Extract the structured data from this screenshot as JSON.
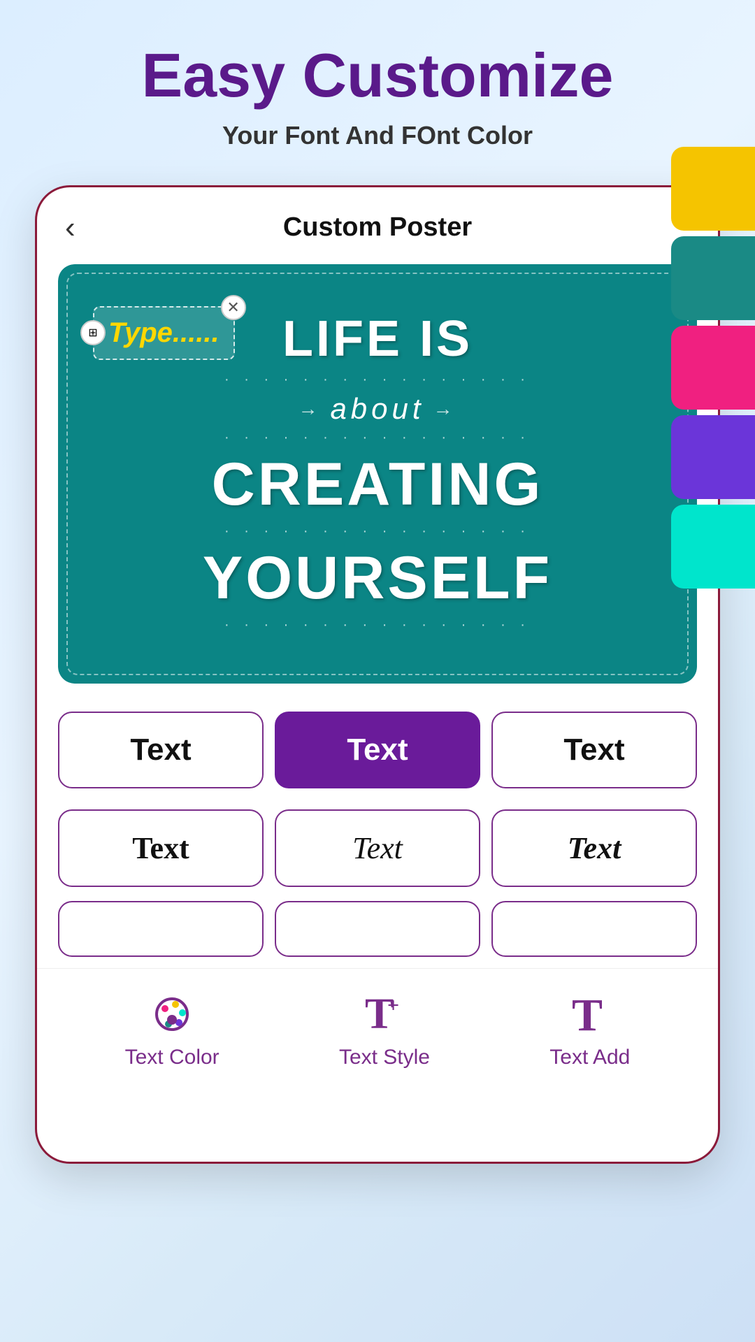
{
  "header": {
    "title": "Easy Customize",
    "subtitle": "Your Font And FOnt Color"
  },
  "app_bar": {
    "title": "Custom Poster",
    "back_label": "‹"
  },
  "poster": {
    "typing_text": "Type......",
    "line1": "LIFE IS",
    "line2": "about",
    "line3": "CREATING",
    "line4": "YOURSELF"
  },
  "colors": [
    {
      "name": "yellow",
      "hex": "#F5C400"
    },
    {
      "name": "teal",
      "hex": "#1a8a85"
    },
    {
      "name": "pink",
      "hex": "#f02080"
    },
    {
      "name": "purple",
      "hex": "#6b35d9"
    },
    {
      "name": "cyan",
      "hex": "#00e5cc"
    }
  ],
  "font_buttons": [
    {
      "label": "Text",
      "style": "normal",
      "active": false
    },
    {
      "label": "Text",
      "style": "normal",
      "active": true
    },
    {
      "label": "Text",
      "style": "normal",
      "active": false
    },
    {
      "label": "Text",
      "style": "serif",
      "active": false
    },
    {
      "label": "Text",
      "style": "script",
      "active": false
    },
    {
      "label": "Text",
      "style": "bold-serif",
      "active": false
    }
  ],
  "bottom_nav": [
    {
      "id": "text-color",
      "label": "Text Color",
      "icon": "palette"
    },
    {
      "id": "text-style",
      "label": "Text Style",
      "icon": "text-style"
    },
    {
      "id": "text-add",
      "label": "Text Add",
      "icon": "text-add"
    }
  ]
}
